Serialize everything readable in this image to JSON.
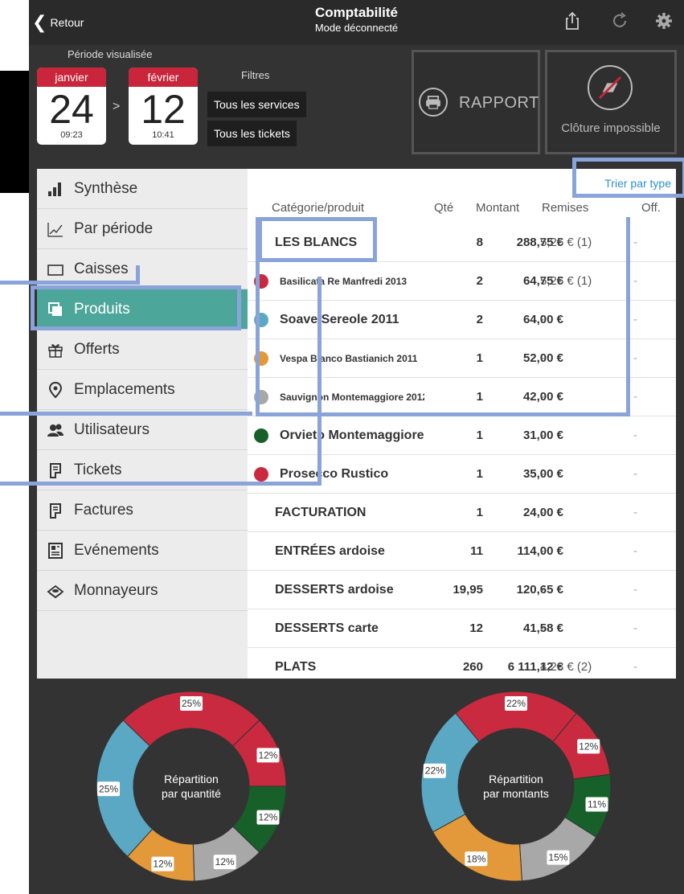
{
  "header": {
    "back_label": "Retour",
    "title": "Comptabilité",
    "subtitle": "Mode déconnecté"
  },
  "period": {
    "label": "Période visualisée",
    "start": {
      "month": "janvier",
      "day": "24",
      "time": "09:23"
    },
    "end": {
      "month": "février",
      "day": "12",
      "time": "10:41"
    },
    "arrow": ">"
  },
  "filters": {
    "label": "Filtres",
    "services": "Tous les services",
    "tickets": "Tous les tickets"
  },
  "actions": {
    "report_label": "RAPPORT",
    "cloture_label": "Clôture impossible"
  },
  "sidebar": {
    "items": [
      {
        "label": "Synthèse",
        "icon": "bar-chart-icon"
      },
      {
        "label": "Par période",
        "icon": "line-chart-icon"
      },
      {
        "label": "Caisses",
        "icon": "register-icon"
      },
      {
        "label": "Produits",
        "icon": "products-icon",
        "active": true
      },
      {
        "label": "Offerts",
        "icon": "gift-icon"
      },
      {
        "label": "Emplacements",
        "icon": "location-pin-icon"
      },
      {
        "label": "Utilisateurs",
        "icon": "users-icon"
      },
      {
        "label": "Tickets",
        "icon": "ticket-icon"
      },
      {
        "label": "Factures",
        "icon": "invoice-icon"
      },
      {
        "label": "Evénements",
        "icon": "events-icon"
      },
      {
        "label": "Monnayeurs",
        "icon": "coin-machine-icon"
      }
    ]
  },
  "table": {
    "sort_label": "Trier par type",
    "headers": {
      "product": "Catégorie/produit",
      "qty": "Qté",
      "amount": "Montant",
      "discounts": "Remises",
      "offered": "Off."
    },
    "rows": [
      {
        "name": "LES BLANCS",
        "qty": "8",
        "amount": "288,75 €",
        "discount": "5,25 € (1)",
        "offered": "-",
        "category": true
      },
      {
        "name": "Basilicata Re Manfredi 2013",
        "qty": "2",
        "amount": "64,75 €",
        "discount": "5,25 € (1)",
        "offered": "-",
        "color": "#c92a3f",
        "small": true
      },
      {
        "name": "Soave Sereole 2011",
        "qty": "2",
        "amount": "64,00 €",
        "discount": "-",
        "offered": "-",
        "color": "#5aa8c4"
      },
      {
        "name": "Vespa Bianco Bastianich 2011",
        "qty": "1",
        "amount": "52,00 €",
        "discount": "-",
        "offered": "-",
        "color": "#e3993a",
        "small": true
      },
      {
        "name": "Sauvignon Montemaggiore 2012",
        "qty": "1",
        "amount": "42,00 €",
        "discount": "-",
        "offered": "-",
        "color": "#a8a8a8",
        "small": true
      },
      {
        "name": "Orvieto Montemaggiore",
        "qty": "1",
        "amount": "31,00 €",
        "discount": "-",
        "offered": "-",
        "color": "#17602a"
      },
      {
        "name": "Prosecco Rustico",
        "qty": "1",
        "amount": "35,00 €",
        "discount": "-",
        "offered": "-",
        "color": "#c92a3f"
      },
      {
        "name": "FACTURATION",
        "qty": "1",
        "amount": "24,00 €",
        "discount": "-",
        "offered": "-",
        "category": true
      },
      {
        "name": "ENTRÉES ardoise",
        "qty": "11",
        "amount": "114,00 €",
        "discount": "-",
        "offered": "-",
        "category": true
      },
      {
        "name": "DESSERTS ardoise",
        "qty": "19,95",
        "amount": "120,65 €",
        "discount": "-",
        "offered": "-",
        "category": true
      },
      {
        "name": "DESSERTS carte",
        "qty": "12",
        "amount": "41,58 €",
        "discount": "-",
        "offered": "-",
        "category": true
      },
      {
        "name": "PLATS",
        "qty": "260",
        "amount": "6 111,12 €",
        "discount": "4,28 € (2)",
        "offered": "-",
        "category": true
      }
    ]
  },
  "chart_data": [
    {
      "type": "pie",
      "title": "Répartition par quantité",
      "title_lines": [
        "Répartition",
        "par quantité"
      ],
      "categories": [
        "25%",
        "12%",
        "12%",
        "12%",
        "12%",
        "25%"
      ],
      "values": [
        25,
        12,
        12,
        12,
        12,
        25
      ],
      "colors": [
        "#c92a3f",
        "#c92a3f",
        "#17602a",
        "#a8a8a8",
        "#e3993a",
        "#5aa8c4"
      ]
    },
    {
      "type": "pie",
      "title": "Répartition par montants",
      "title_lines": [
        "Répartition",
        "par montants"
      ],
      "categories": [
        "22%",
        "12%",
        "11%",
        "15%",
        "18%",
        "22%"
      ],
      "values": [
        22,
        12,
        11,
        15,
        18,
        22
      ],
      "colors": [
        "#c92a3f",
        "#c92a3f",
        "#17602a",
        "#a8a8a8",
        "#e3993a",
        "#5aa8c4"
      ]
    }
  ]
}
